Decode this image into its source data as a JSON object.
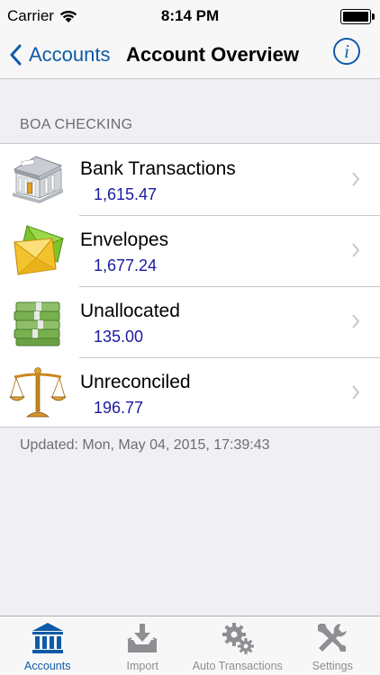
{
  "status_bar": {
    "carrier": "Carrier",
    "time": "8:14 PM",
    "battery_level": 1.0
  },
  "nav": {
    "back_label": "Accounts",
    "title": "Account Overview",
    "info_glyph": "i"
  },
  "section": {
    "header": "BOA CHECKING",
    "rows": [
      {
        "title": "Bank Transactions",
        "value": "1,615.47",
        "icon": "bank-building-icon"
      },
      {
        "title": "Envelopes",
        "value": "1,677.24",
        "icon": "envelope-icon"
      },
      {
        "title": "Unallocated",
        "value": "135.00",
        "icon": "money-stack-icon"
      },
      {
        "title": "Unreconciled",
        "value": "196.77",
        "icon": "scales-icon"
      }
    ]
  },
  "updated_text": "Updated: Mon, May 04, 2015, 17:39:43",
  "tabs": [
    {
      "label": "Accounts",
      "icon": "bank-icon",
      "active": true
    },
    {
      "label": "Import",
      "icon": "import-tray-icon",
      "active": false
    },
    {
      "label": "Auto Transactions",
      "icon": "gears-icon",
      "active": false
    },
    {
      "label": "Settings",
      "icon": "tools-icon",
      "active": false
    }
  ],
  "colors": {
    "accent": "#0f5ba7",
    "value_text": "#1a1aa3",
    "background": "#efeff4"
  }
}
